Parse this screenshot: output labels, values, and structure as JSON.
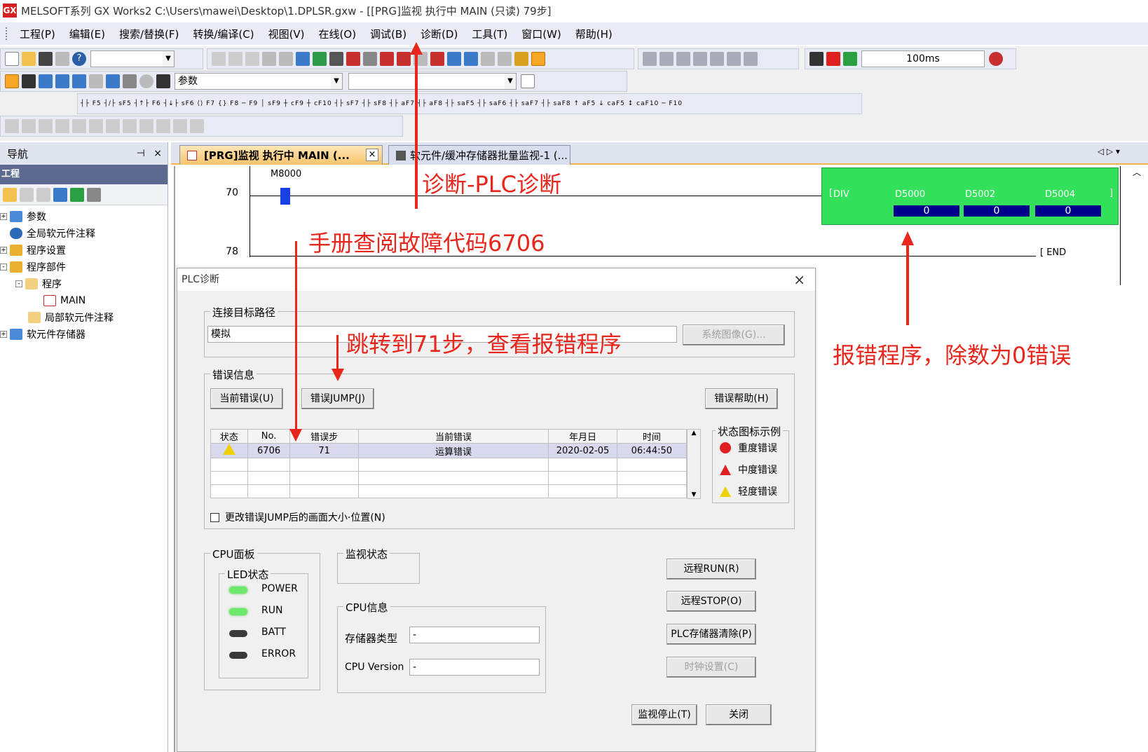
{
  "window": {
    "app_icon": "GX",
    "title": "MELSOFT系列 GX Works2 C:\\Users\\mawei\\Desktop\\1.DPLSR.gxw - [[PRG]监视 执行中 MAIN (只读) 79步]"
  },
  "menu": [
    "工程(P)",
    "编辑(E)",
    "搜索/替换(F)",
    "转换/编译(C)",
    "视图(V)",
    "在线(O)",
    "调试(B)",
    "诊断(D)",
    "工具(T)",
    "窗口(W)",
    "帮助(H)"
  ],
  "toolbar": {
    "scan_time": "100ms",
    "param_combo": "参数",
    "fkeys_row": [
      "F5",
      "sF5",
      "F6",
      "sF6",
      "F7",
      "F8",
      "F9",
      "sF9",
      "cF9",
      "cF10",
      "sF7",
      "sF8",
      "aF7",
      "aF8",
      "saF5",
      "saF6",
      "saF7",
      "saF8",
      "aF5",
      "caF5",
      "caF10",
      "F10"
    ]
  },
  "nav": {
    "title": "导航",
    "pin": "ᵖ",
    "close": "×",
    "section": "工程",
    "tree": [
      {
        "label": "参数",
        "level": 0,
        "expander": "+"
      },
      {
        "label": "全局软元件注释",
        "level": 0,
        "expander": ""
      },
      {
        "label": "程序设置",
        "level": 0,
        "expander": "+"
      },
      {
        "label": "程序部件",
        "level": 0,
        "expander": "-"
      },
      {
        "label": "程序",
        "level": 1,
        "expander": "-"
      },
      {
        "label": "MAIN",
        "level": 2,
        "expander": ""
      },
      {
        "label": "局部软元件注释",
        "level": 1,
        "expander": ""
      },
      {
        "label": "软元件存储器",
        "level": 0,
        "expander": "+"
      }
    ]
  },
  "tabs": [
    {
      "label": "[PRG]监视 执行中 MAIN (...",
      "active": true
    },
    {
      "label": "软元件/缓冲存储器批量监视-1 (...",
      "active": false
    }
  ],
  "ladder": {
    "rungs": [
      {
        "step": "70",
        "contact": "M8000",
        "instruction": "DIV",
        "operands": [
          "D5000",
          "D5002",
          "D5004"
        ],
        "values": [
          "0",
          "0",
          "0"
        ]
      },
      {
        "step": "78",
        "instruction": "END"
      }
    ]
  },
  "dialog": {
    "title": "PLC诊断",
    "close": "×",
    "connection_group": "连接目标路径",
    "connection_value": "模拟",
    "system_image_btn": "系统图像(G)...",
    "error_group": "错误信息",
    "current_error_btn": "当前错误(U)",
    "error_jump_btn": "错误JUMP(J)",
    "error_help_btn": "错误帮助(H)",
    "table": {
      "headers": [
        "状态",
        "No.",
        "错误步",
        "当前错误",
        "年月日",
        "时间"
      ],
      "rows": [
        {
          "status_icon": "warning-icon",
          "no": "6706",
          "step": "71",
          "error": "运算错误",
          "date": "2020-02-05",
          "time": "06:44:50"
        }
      ]
    },
    "legend_group": "状态图标示例",
    "legend": [
      {
        "icon": "major-error-icon",
        "label": "重度错误",
        "color": "#e02020"
      },
      {
        "icon": "moderate-error-icon",
        "label": "中度错误",
        "color": "#e02020"
      },
      {
        "icon": "minor-error-icon",
        "label": "轻度错误",
        "color": "#f0d000"
      }
    ],
    "jump_checkbox": "更改错误JUMP后的画面大小·位置(N)",
    "cpu_panel_group": "CPU面板",
    "led_group": "LED状态",
    "leds": [
      {
        "label": "POWER",
        "on": true
      },
      {
        "label": "RUN",
        "on": true
      },
      {
        "label": "BATT",
        "on": false
      },
      {
        "label": "ERROR",
        "on": false
      }
    ],
    "monitor_group": "监视状态",
    "cpu_info_group": "CPU信息",
    "memory_type_label": "存储器类型",
    "memory_type_value": "-",
    "cpu_version_label": "CPU Version",
    "cpu_version_value": "-",
    "remote_run_btn": "远程RUN(R)",
    "remote_stop_btn": "远程STOP(O)",
    "plc_clear_btn": "PLC存储器清除(P)",
    "clock_btn": "时钟设置(C)",
    "monitor_stop_btn": "监视停止(T)",
    "close_btn": "关闭"
  },
  "annotations": {
    "diag": "诊断-PLC诊断",
    "manual": "手册查阅故障代码6706",
    "jump": "跳转到71步，查看报错程序",
    "error_prog": "报错程序，除数为0错误"
  },
  "colors": {
    "annotation": "#e8261c",
    "div_box": "#33e05a",
    "value_cell": "#00008b",
    "active_tab_accent": "#f6b34a"
  }
}
